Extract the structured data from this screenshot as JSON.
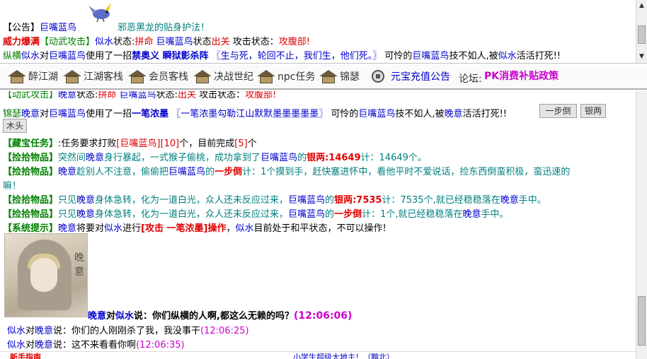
{
  "top": {
    "line1": {
      "prefix": "【公告】",
      "name": "巨嘴蓝鸟",
      "text": "邪恶黑龙的贴身护法！"
    },
    "line2": {
      "state1": "威力爆满",
      "tag": "【动武攻击】",
      "actor": "似水",
      "s1": "状态:",
      "v1": "拼命",
      "target": "巨嘴蓝鸟",
      "s2": "状态",
      "v2": "出关",
      "s3": "攻击状态：",
      "v3": "攻腹部!"
    },
    "line3": {
      "p1": "纵横",
      "actor": "似水",
      "t1": "对",
      "target": "巨嘴蓝鸟",
      "t2": "使用了一招",
      "skill": "禁奥义 瞬狱影杀阵",
      "quote": "〖生与死，轮回不止，我们生，他们死。〗",
      "t3": "可怜的",
      "target2": "巨嘴蓝鸟",
      "t4": "技不如人,被",
      "actor2": "似水",
      "t5": "活活打死!!"
    }
  },
  "nav": {
    "items": [
      {
        "label": "醉江湖",
        "icon": "inn-house-icon"
      },
      {
        "label": "江湖客栈",
        "icon": "inn-house-icon"
      },
      {
        "label": "会员客栈",
        "icon": "inn-house-icon"
      },
      {
        "label": "决战世纪",
        "icon": "inn-house-icon"
      },
      {
        "label": "npc任务",
        "icon": "inn-house-icon"
      },
      {
        "label": "锦瑟",
        "icon": "inn-house-icon"
      },
      {
        "label": "元宝充值公告",
        "icon": "coin-icon"
      }
    ],
    "forum_label": "论坛:",
    "forum_link": "PK消费补贴政策"
  },
  "main": {
    "partial_top": {
      "tag": "【动武攻击】",
      "actor": "晚意",
      "s1": "状态:",
      "v1": "拼命",
      "target": "巨嘴蓝鸟",
      "s2": "状态:",
      "v2": "出关",
      "s3": "攻击状态：",
      "v3": "攻腹部!"
    },
    "attack": {
      "p1": "锦瑟",
      "actor": "晚意",
      "t1": "对",
      "target": "巨嘴蓝鸟",
      "t2": "使用了一招",
      "skill": "一笔浓墨",
      "quote": "〖一笔浓墨勾勒江山默默墨墨墨墨墨〗",
      "t3": "可怜的",
      "target2": "巨嘴蓝鸟",
      "t4": "技不如人,被",
      "actor2": "晚意",
      "t5": "活活打死!!"
    },
    "buttons": {
      "step": "一步倒",
      "silver": "银两",
      "wood": "木头"
    },
    "quest": {
      "tag": "【藏宝任务】",
      "t1": ":任务要求打败",
      "target": "[巨嘴蓝鸟]",
      "count": "[10]",
      "t2": "个，目前完成",
      "done": "[5]",
      "t3": "个"
    },
    "loot1": {
      "tag": "【捡拾物品】",
      "t1": "突然间",
      "actor": "晚意",
      "t2": "身行暴起，一式猴子偷桃，成功拿到了",
      "target": "巨嘴蓝鸟",
      "t3": "的",
      "item": "银两:14649",
      "t4": "计：14649个。"
    },
    "loot2": {
      "tag": "【捡拾物品】",
      "actor": "晚意",
      "t1": "趁别人不注意，偷偷把",
      "target": "巨嘴蓝鸟",
      "t2": "的",
      "item": "一步倒",
      "t3": "计：1个摸到手，赶快塞进怀中，看他平时不爱说话，捡东西倒蛮积极，蛮迅速的",
      "t4": "嘛！"
    },
    "loot3": {
      "tag": "【捡拾物品】",
      "t1": "只见",
      "actor": "晚意",
      "t2": "身体急转，化为一道白光，众人还未反应过来，",
      "target": "巨嘴蓝鸟",
      "t3": "的",
      "item": "银两:7535",
      "t4": "计：7535个,就已经稳稳落在",
      "actor2": "晚意",
      "t5": "手中。"
    },
    "loot4": {
      "tag": "【捡拾物品】",
      "t1": "只见",
      "actor": "晚意",
      "t2": "身体急转，化为一道白光，众人还未反应过来，",
      "target": "巨嘴蓝鸟",
      "t3": "的",
      "item": "一步倒",
      "t4": "计：1个,就已经稳稳落在",
      "actor2": "晚意",
      "t5": "手中。"
    },
    "system": {
      "tag": "【系统提示】",
      "actor": "晚意",
      "t1": "将要对",
      "target": "似水",
      "t2": "进行",
      "action": "[攻击 一笔浓墨]操作",
      "t3": "，",
      "target2": "似水",
      "t4": "目前处于和平状态，不可以操作!"
    },
    "avatar_name": "晚意",
    "chat1": {
      "from": "晚意",
      "t1": "对",
      "to": "似水",
      "t2": "说：你们纵横的人啊,都这么无赖的吗？",
      "time": "(12:06:06)"
    },
    "chat2": {
      "from": "似水",
      "t1": "对",
      "to": "晚意",
      "t2": "说：你们的人刚刚杀了我，我没事干",
      "time": "(12:06:25)"
    },
    "chat3": {
      "from": "似水",
      "t1": "对",
      "to": "晚意",
      "t2": "说：这不来看看你啊",
      "time": "(12:06:35)"
    },
    "hint_left": "新手指南",
    "hint_mid": "小学生超级大地主！（黯北）"
  }
}
